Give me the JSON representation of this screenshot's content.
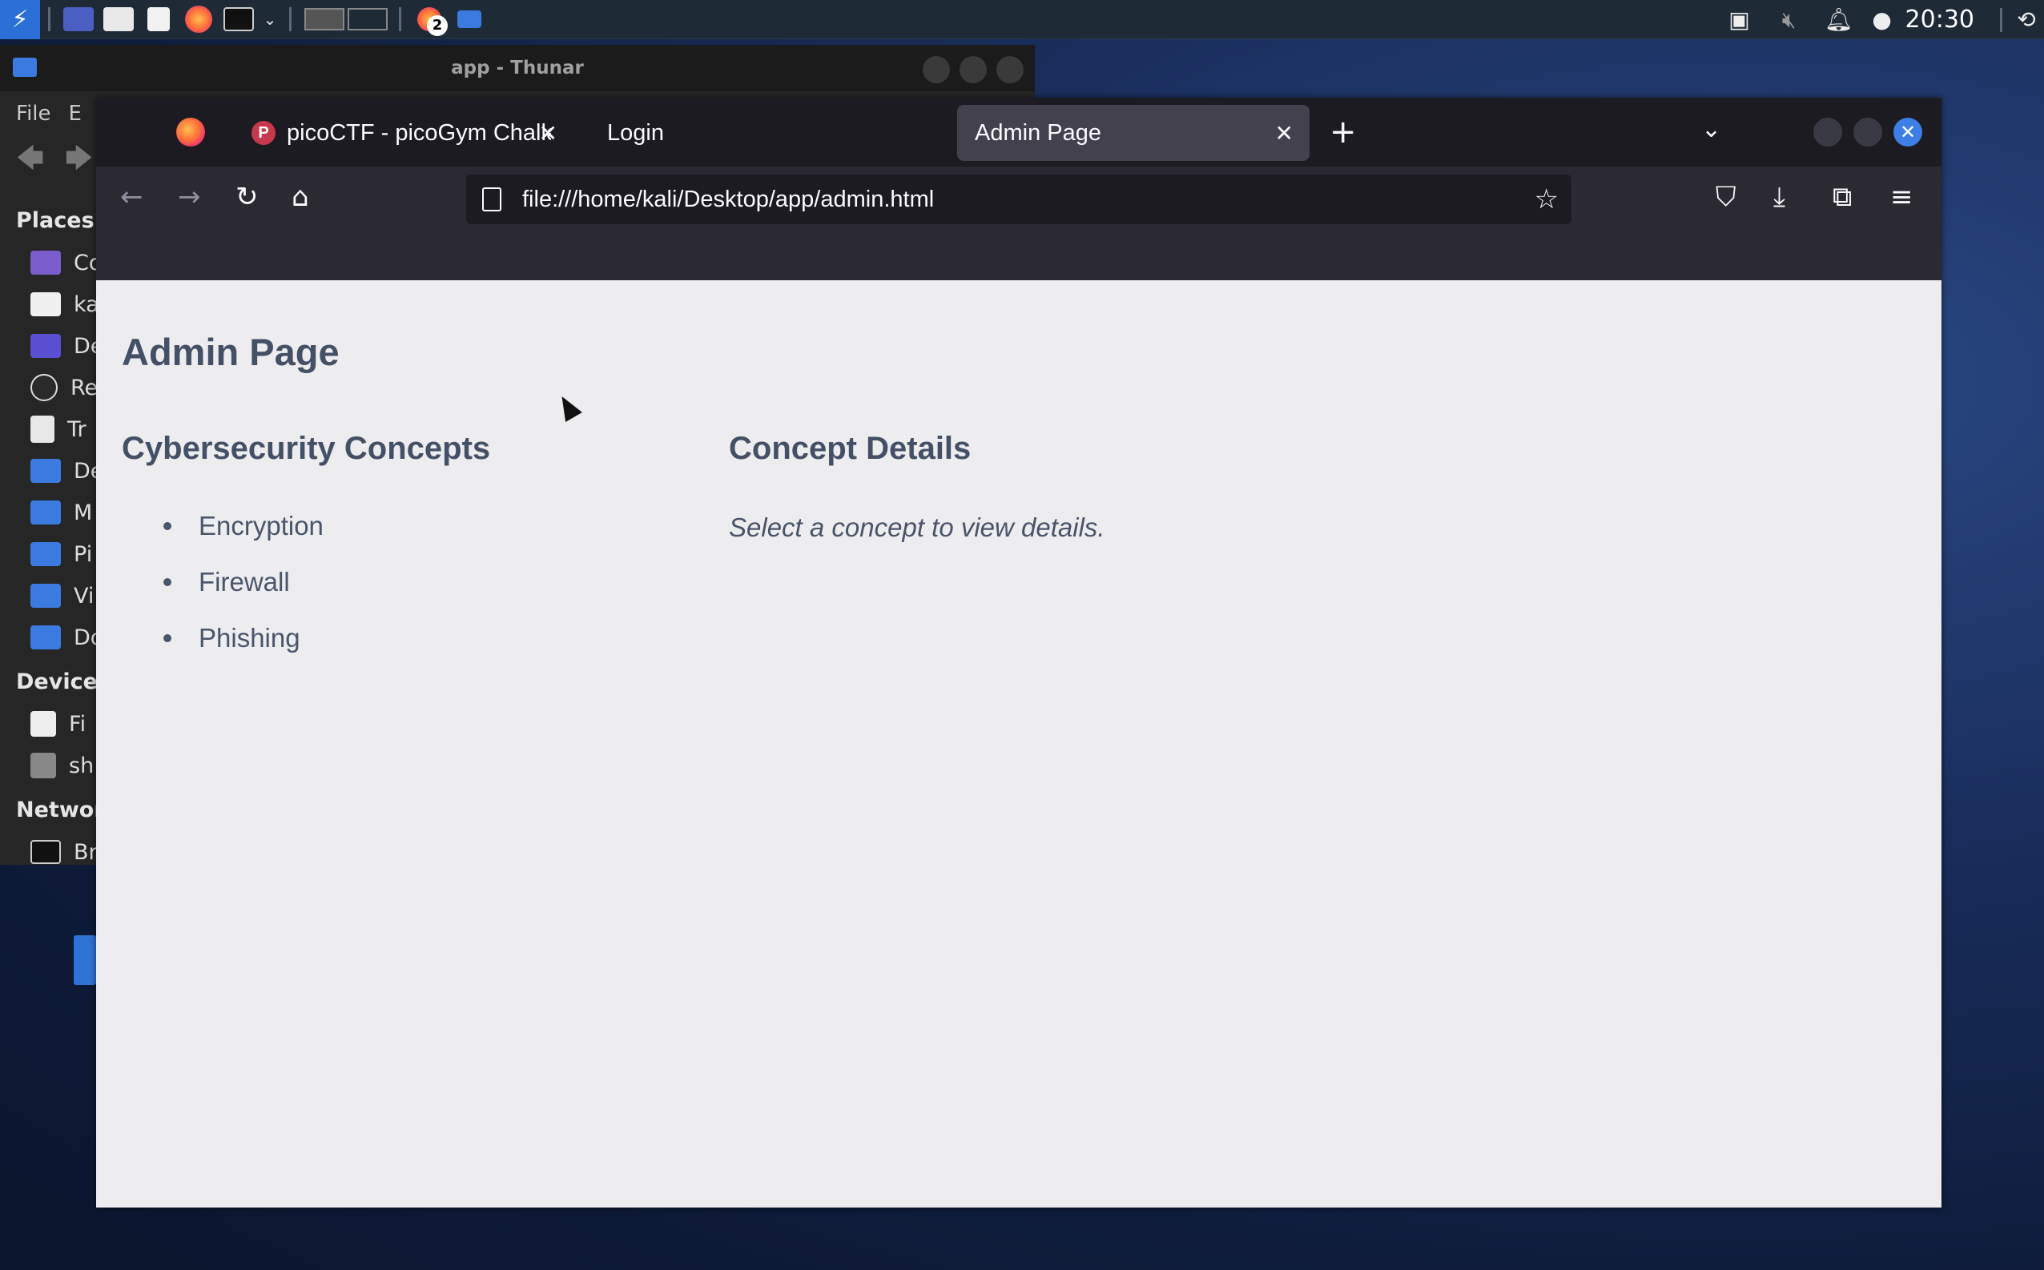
{
  "panel": {
    "workspace_badge": "2",
    "clock": "20:30"
  },
  "thunar": {
    "title": "app - Thunar",
    "menu": [
      "File",
      "E"
    ],
    "places_header": "Places",
    "places": [
      "Co",
      "ka",
      "De",
      "Re",
      "Tr",
      "De",
      "M",
      "Pi",
      "Vi",
      "Do"
    ],
    "devices_header": "Devices",
    "devices": [
      "Fi",
      "sh"
    ],
    "network_header": "Networ",
    "network": [
      "Br"
    ]
  },
  "firefox": {
    "tabs": [
      {
        "title": "picoCTF - picoGym Challe",
        "favicon": "P"
      },
      {
        "title": "Login"
      },
      {
        "title": "Admin Page"
      }
    ],
    "url": "file:///home/kali/Desktop/app/admin.html"
  },
  "page": {
    "title": "Admin Page",
    "concepts_heading": "Cybersecurity Concepts",
    "concepts": [
      "Encryption",
      "Firewall",
      "Phishing"
    ],
    "details_heading": "Concept Details",
    "details_placeholder": "Select a concept to view details."
  },
  "colors": {
    "panel_bg": "#1e2a36",
    "kali_blue": "#2c6fd6",
    "tab_active_bg": "#42414d",
    "page_bg": "#ededf0",
    "heading_text": "#445066"
  }
}
